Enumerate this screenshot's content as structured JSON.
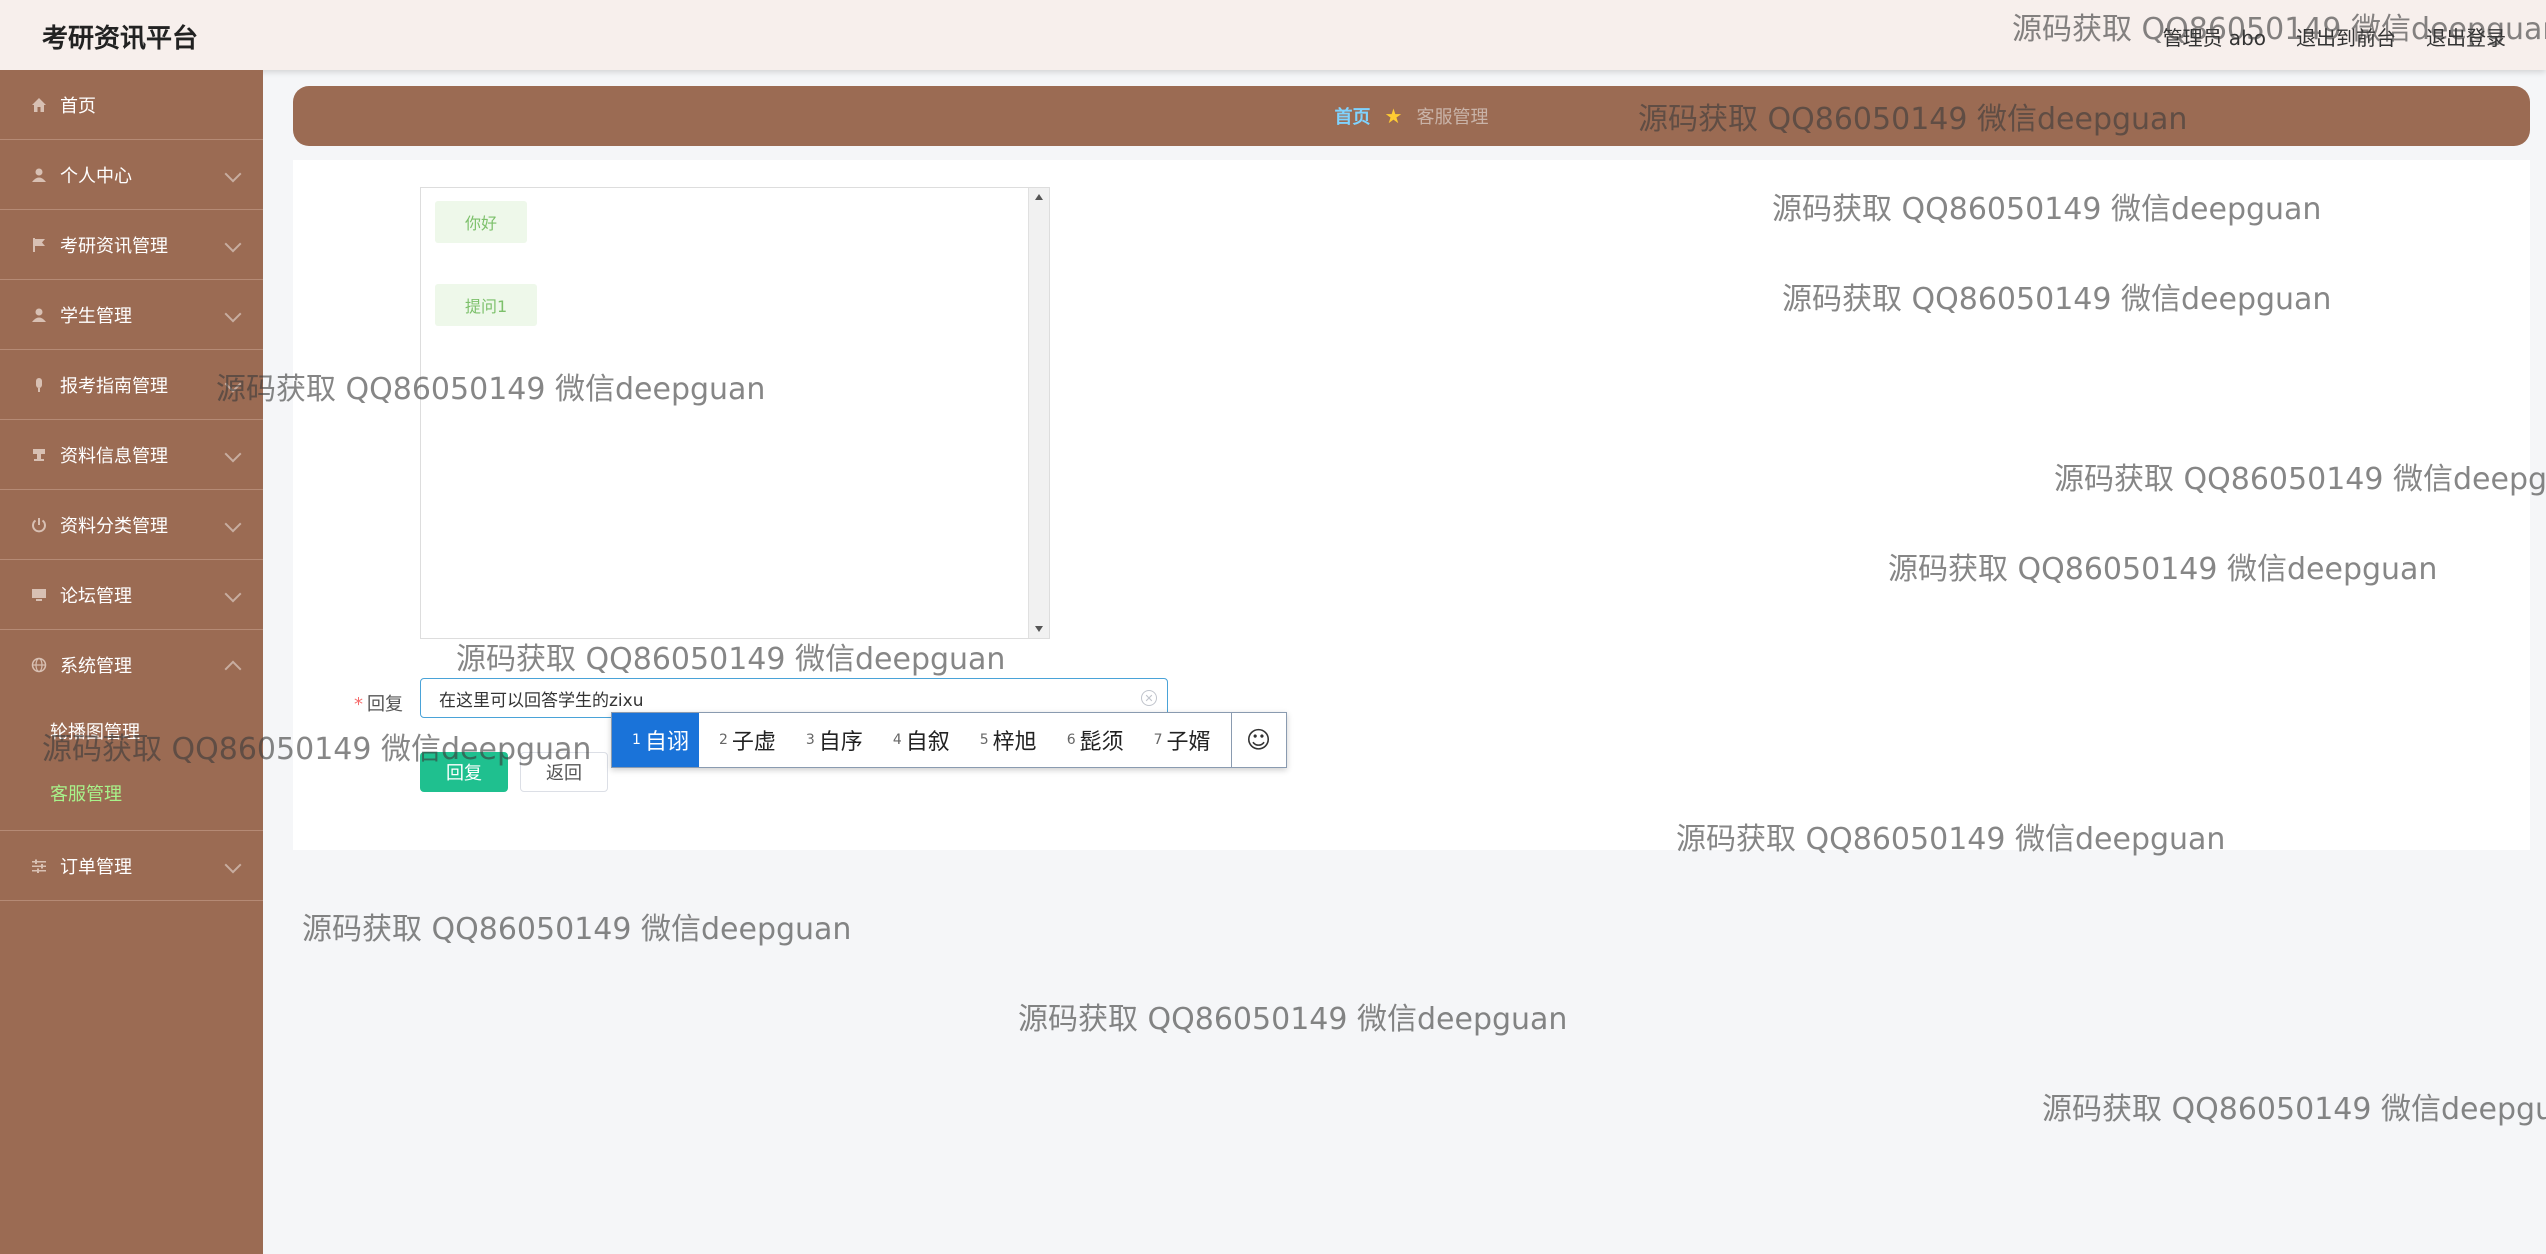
{
  "app": {
    "title": "考研资讯平台"
  },
  "header": {
    "user_label": "管理员 abo",
    "goto_front": "退出到前台",
    "logout": "退出登录"
  },
  "sidebar": {
    "items": [
      {
        "label": "首页",
        "icon": "home-icon"
      },
      {
        "label": "个人中心",
        "icon": "user-icon"
      },
      {
        "label": "考研资讯管理",
        "icon": "flag-icon"
      },
      {
        "label": "学生管理",
        "icon": "user-icon"
      },
      {
        "label": "报考指南管理",
        "icon": "mic-icon"
      },
      {
        "label": "资料信息管理",
        "icon": "stamp-icon"
      },
      {
        "label": "资料分类管理",
        "icon": "power-icon"
      },
      {
        "label": "论坛管理",
        "icon": "monitor-icon"
      },
      {
        "label": "系统管理",
        "icon": "globe-icon"
      },
      {
        "label": "订单管理",
        "icon": "sliders-icon"
      }
    ],
    "system_sub": [
      {
        "label": "轮播图管理"
      },
      {
        "label": "客服管理"
      }
    ]
  },
  "breadcrumb": {
    "home": "首页",
    "current": "客服管理"
  },
  "chat": {
    "messages": [
      {
        "text": "你好"
      },
      {
        "text": "提问1"
      }
    ]
  },
  "form": {
    "reply_label": "回复",
    "reply_value": "在这里可以回答学生的zixu",
    "reply_button": "回复",
    "back_button": "返回"
  },
  "ime": {
    "candidates": [
      {
        "num": "1",
        "text": "自诩"
      },
      {
        "num": "2",
        "text": "子虚"
      },
      {
        "num": "3",
        "text": "自序"
      },
      {
        "num": "4",
        "text": "自叙"
      },
      {
        "num": "5",
        "text": "梓旭"
      },
      {
        "num": "6",
        "text": "髭须"
      },
      {
        "num": "7",
        "text": "子婿"
      }
    ],
    "emoji": "☺"
  },
  "watermark": {
    "text": "源码获取 QQ86050149 微信deepguan"
  },
  "colors": {
    "sidebar": "#9b6b53",
    "accent": "#1fc08f",
    "active_sub": "#a8f28a",
    "ime_selected": "#1a73d9"
  }
}
